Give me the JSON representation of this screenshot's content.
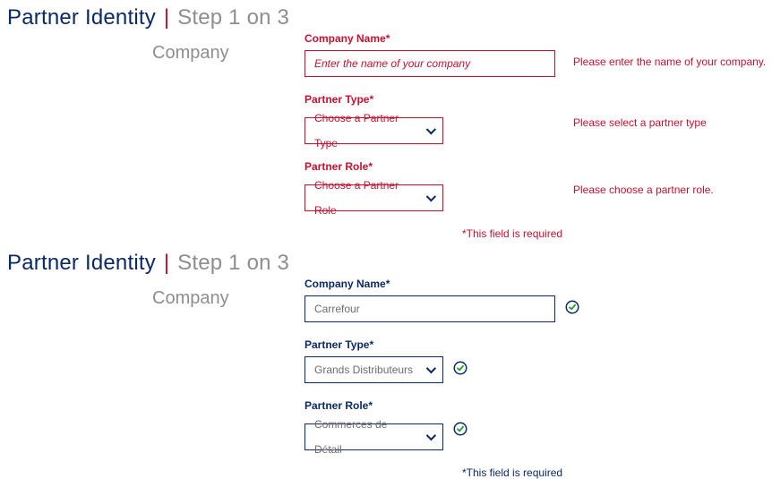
{
  "header": {
    "title": "Partner Identity",
    "separator": "|",
    "step_text": "Step 1 on 3"
  },
  "section_label": "Company",
  "error_block": {
    "company": {
      "label": "Company Name*",
      "placeholder": "Enter the name of your company",
      "error": "Please enter the name of your company."
    },
    "partner_type": {
      "label": "Partner Type*",
      "value": "Choose a Partner Type",
      "error": "Please select a partner type"
    },
    "partner_role": {
      "label": "Partner Role*",
      "value": "Choose a Partner Role",
      "error": "Please choose a partner role."
    },
    "required_note": "*This field is required"
  },
  "valid_block": {
    "company": {
      "label": "Company Name*",
      "value": "Carrefour"
    },
    "partner_type": {
      "label": "Partner Type*",
      "value": "Grands Distributeurs"
    },
    "partner_role": {
      "label": "Partner Role*",
      "value": "Commerces de Détail"
    },
    "required_note": "*This field is required"
  }
}
